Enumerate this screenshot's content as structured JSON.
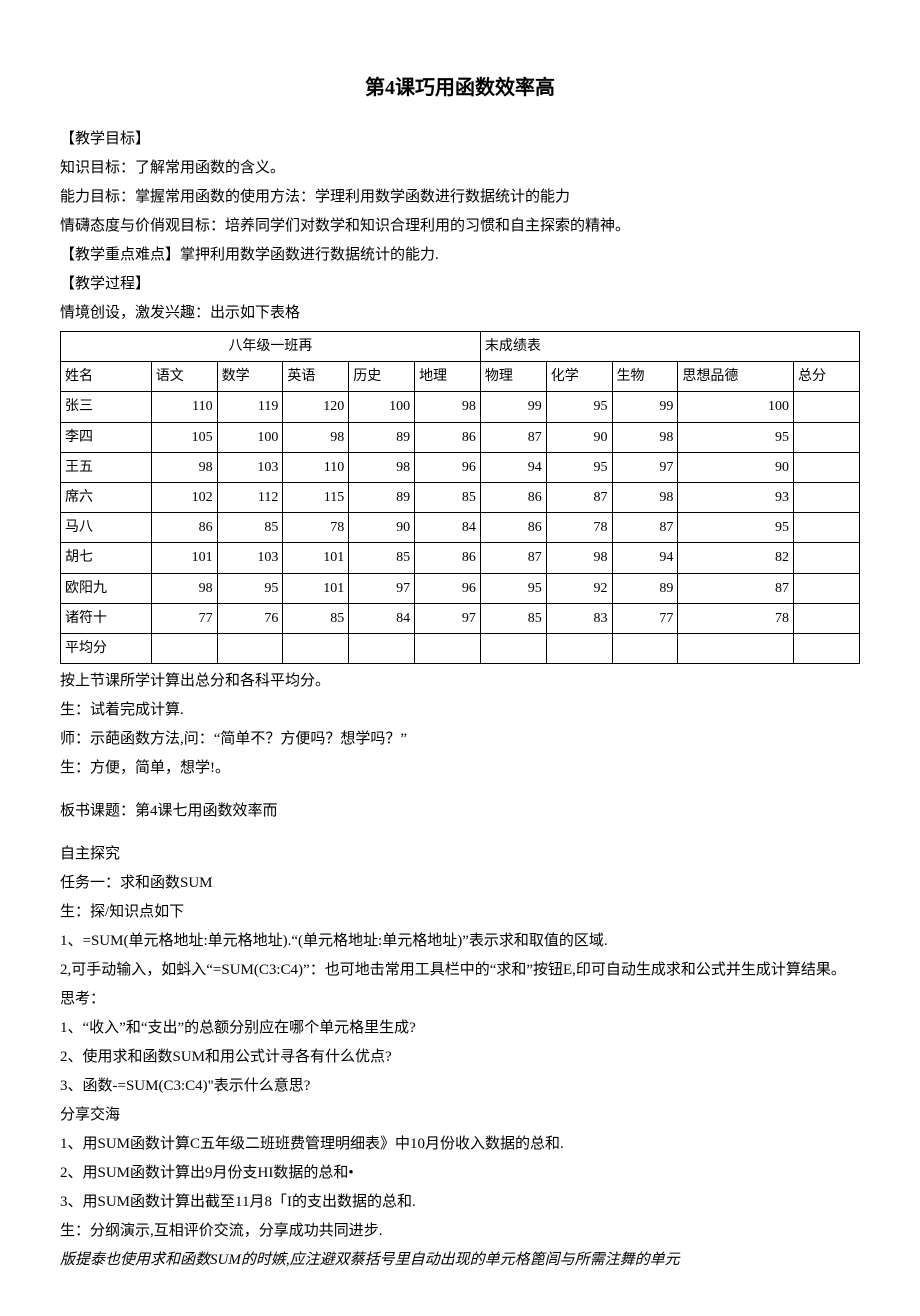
{
  "title": "第4课巧用函数效率高",
  "p1": "【教学目标】",
  "p2": "知识目标：了解常用函数的含义。",
  "p3": "能力目标：掌握常用函数的使用方法：学理利用数学函数进行数据统计的能力",
  "p4": "情礴态度与价俏观目标：培养同学们对数学和知识合理利用的习惯和自主探索的精神。",
  "p5": "【教学重点难点】掌押利用数学函数进行数据统计的能力.",
  "p6": "【教学过程】",
  "p7": "情境创设，激发兴趣：出示如下表格",
  "table": {
    "title_left": "八年级一班再",
    "title_right": "末成绩表",
    "headers": [
      "姓名",
      "语文",
      "数学",
      "英语",
      "历史",
      "地理",
      "物理",
      "化学",
      "生物",
      "思想品德",
      "总分"
    ],
    "rows": [
      [
        "张三",
        "110",
        "119",
        "120",
        "100",
        "98",
        "99",
        "95",
        "99",
        "100",
        ""
      ],
      [
        "李四",
        "105",
        "100",
        "98",
        "89",
        "86",
        "87",
        "90",
        "98",
        "95",
        ""
      ],
      [
        "王五",
        "98",
        "103",
        "110",
        "98",
        "96",
        "94",
        "95",
        "97",
        "90",
        ""
      ],
      [
        "席六",
        "102",
        "112",
        "115",
        "89",
        "85",
        "86",
        "87",
        "98",
        "93",
        ""
      ],
      [
        "马八",
        "86",
        "85",
        "78",
        "90",
        "84",
        "86",
        "78",
        "87",
        "95",
        ""
      ],
      [
        "胡七",
        "101",
        "103",
        "101",
        "85",
        "86",
        "87",
        "98",
        "94",
        "82",
        ""
      ],
      [
        "欧阳九",
        "98",
        "95",
        "101",
        "97",
        "96",
        "95",
        "92",
        "89",
        "87",
        ""
      ],
      [
        "诸符十",
        "77",
        "76",
        "85",
        "84",
        "97",
        "85",
        "83",
        "77",
        "78",
        ""
      ],
      [
        "平均分",
        "",
        "",
        "",
        "",
        "",
        "",
        "",
        "",
        "",
        ""
      ]
    ]
  },
  "p8": "按上节课所学计算出总分和各科平均分。",
  "p9": "生：试着完成计算.",
  "p10": "师：示葩函数方法,问：“简单不？方便吗？想学吗？”",
  "p11": "生：方便，简单，想学!。",
  "p12": "板书课题：第4课七用函数效率而",
  "p13": "自主探究",
  "p14": "任务一：求和函数SUM",
  "p15": "生：探/知识点如下",
  "p16": "1、=SUM(单元格地址:单元格地址).“(单元格地址:单元格地址)”表示求和取值的区域.",
  "p17": "2,可手动输入，如蚪入“=SUM(C3:C4)”：也可地击常用工具栏中的“求和”按钮E,印可自动生成求和公式并生成计算结果。",
  "p18": "思考：",
  "p19": "1、“收入”和“支出”的总额分别应在哪个单元格里生成?",
  "p20": "2、使用求和函数SUM和用公式计寻各有什么优点?",
  "p21": "3、函数-=SUM(C3:C4)\"表示什么意思?",
  "p22": "分享交海",
  "p23": "1、用SUM函数计算C五年级二班班费管理明细表》中10月份收入数据的总和.",
  "p24": "2、用SUM函数计算出9月份支HI数据的总和•",
  "p25": "3、用SUM函数计算出截至11月8「I的支出数据的总和.",
  "p26": "生：分纲演示,互相评价交流，分享成功共同进步.",
  "p27": "版提泰也使用求和函数SUM的时嫉,应注避双蔡括号里自动出现的单元格篦闾与所需注舞的单元"
}
